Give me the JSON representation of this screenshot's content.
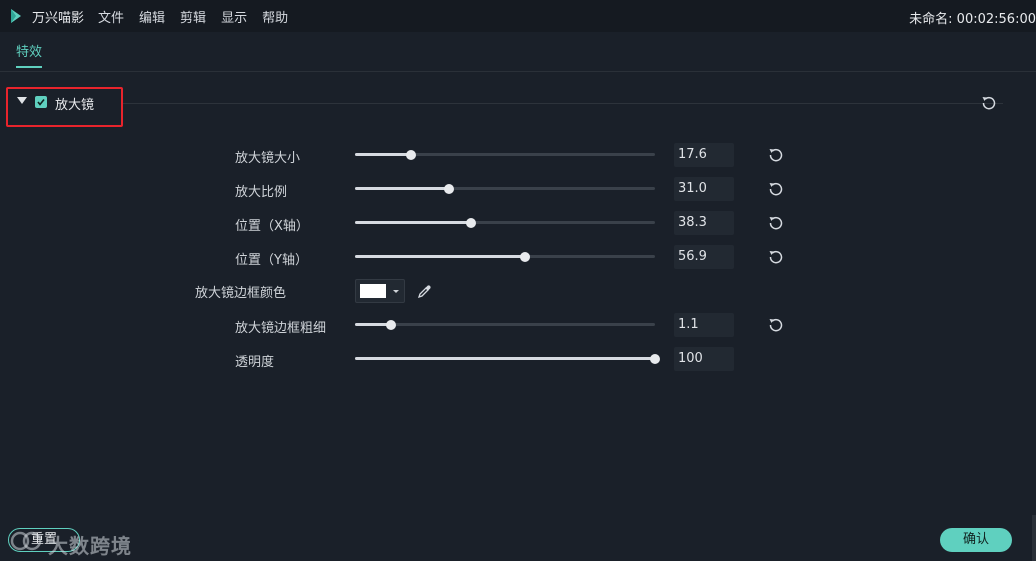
{
  "app": {
    "title": "万兴喵影",
    "project_info": "未命名: 00:02:56:00"
  },
  "menu": [
    "文件",
    "编辑",
    "剪辑",
    "显示",
    "帮助"
  ],
  "tabs": [
    {
      "label": "特效",
      "active": true
    }
  ],
  "section": {
    "title": "放大镜",
    "enabled": true,
    "expanded": true
  },
  "params": [
    {
      "label": "放大镜大小",
      "value": "17.6",
      "level": 0.187
    },
    {
      "label": "放大比例",
      "value": "31.0",
      "level": 0.313
    },
    {
      "label": "位置（X轴）",
      "value": "38.3",
      "level": 0.387
    },
    {
      "label": "位置（Y轴）",
      "value": "56.9",
      "level": 0.567
    },
    {
      "label": "放大镜边框粗细",
      "value": "1.1",
      "level": 0.12
    },
    {
      "label": "透明度",
      "value": "100",
      "level": 1.0
    }
  ],
  "border_color": {
    "label": "放大镜边框颜色",
    "swatch": "#ffffff"
  },
  "buttons": {
    "reset": "重置",
    "confirm": "确认"
  },
  "watermark": "大数跨境",
  "colors": {
    "accent": "#5fd0bf",
    "highlight_border": "#e8242c",
    "background": "#1a2029"
  }
}
